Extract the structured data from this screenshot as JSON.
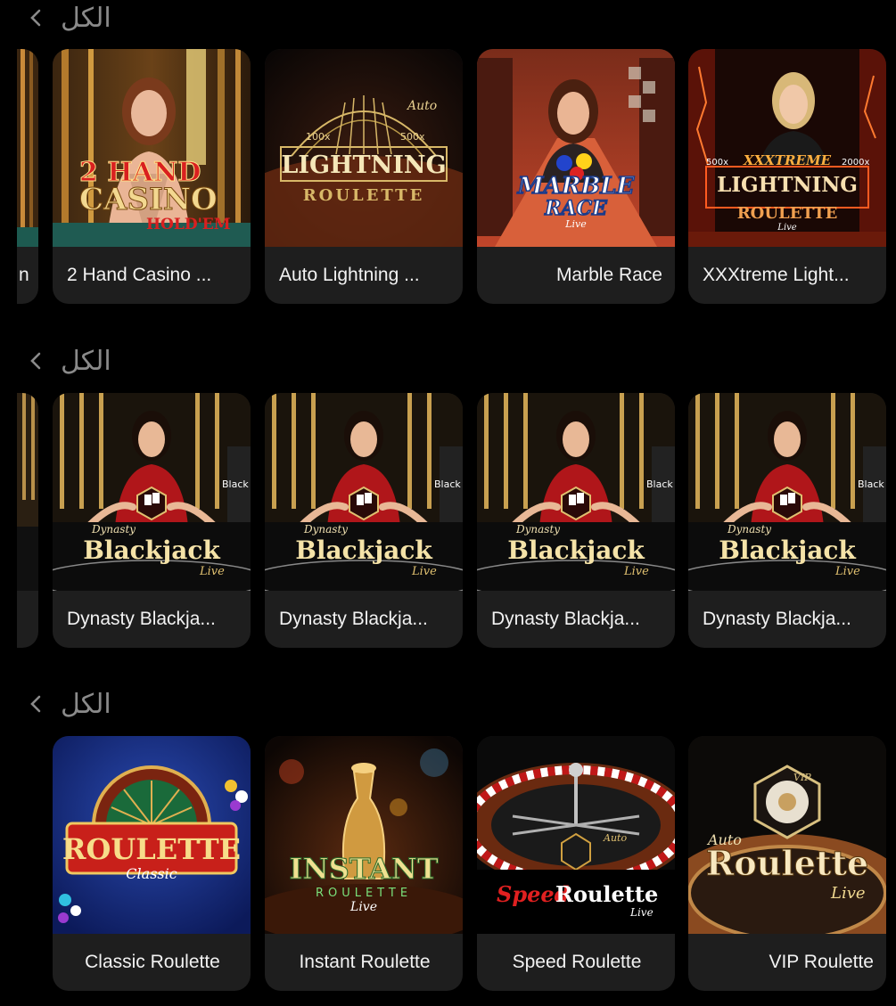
{
  "sections": [
    {
      "see_all": "الكل",
      "cards": [
        {
          "title": "2 Hand Casino ...",
          "thumb": {
            "line1": "2 HAND",
            "line2": "CASINO",
            "line3": "HOLD'EM"
          }
        },
        {
          "title": "Auto Lightning ...",
          "thumb": {
            "line1": "Auto",
            "line2": "LIGHTNING",
            "line3": "ROULETTE",
            "m1": "100x",
            "m2": "500x"
          }
        },
        {
          "title": "Marble Race",
          "thumb": {
            "line1": "MARBLE",
            "line2": "RACE",
            "line3": "Live"
          }
        },
        {
          "title": "XXXtreme Light...",
          "thumb": {
            "line1": "XXXTREME",
            "line2": "LIGHTNING",
            "line3": "ROULETTE",
            "m1": "500x",
            "m2": "2000x",
            "line4": "Live"
          }
        }
      ]
    },
    {
      "see_all": "الكل",
      "cards": [
        {
          "title": "Dynasty Blackja...",
          "thumb": {
            "line1": "Dynasty",
            "line2": "Blackjack",
            "line3": "Live",
            "corner": "Black"
          }
        },
        {
          "title": "Dynasty Blackja...",
          "thumb": {
            "line1": "Dynasty",
            "line2": "Blackjack",
            "line3": "Live",
            "corner": "Black"
          }
        },
        {
          "title": "Dynasty Blackja...",
          "thumb": {
            "line1": "Dynasty",
            "line2": "Blackjack",
            "line3": "Live",
            "corner": "Black"
          }
        },
        {
          "title": "Dynasty Blackja...",
          "thumb": {
            "line1": "Dynasty",
            "line2": "Blackjack",
            "line3": "Live",
            "corner": "Black"
          }
        }
      ]
    },
    {
      "see_all": "الكل",
      "cards": [
        {
          "title": "Classic Roulette",
          "thumb": {
            "line1": "ROULETTE",
            "line2": "Classic"
          }
        },
        {
          "title": "Instant Roulette",
          "thumb": {
            "line1": "INSTANT",
            "line2": "ROULETTE",
            "line3": "Live"
          }
        },
        {
          "title": "Speed Roulette",
          "thumb": {
            "line1": "Auto",
            "line2": "Speed",
            "line3": "Roulette",
            "line4": "Live"
          }
        },
        {
          "title": "VIP Roulette",
          "thumb": {
            "line1": "VIP",
            "line2": "Auto",
            "line3": "Roulette",
            "line4": "Live"
          }
        }
      ]
    }
  ],
  "partial_card_titles": [
    "n"
  ],
  "colors": {
    "background": "#000000",
    "card": "#1e1e1e",
    "text": "#f2f2f2",
    "muted": "#8a8a8a",
    "gold": "#e6c56a"
  }
}
